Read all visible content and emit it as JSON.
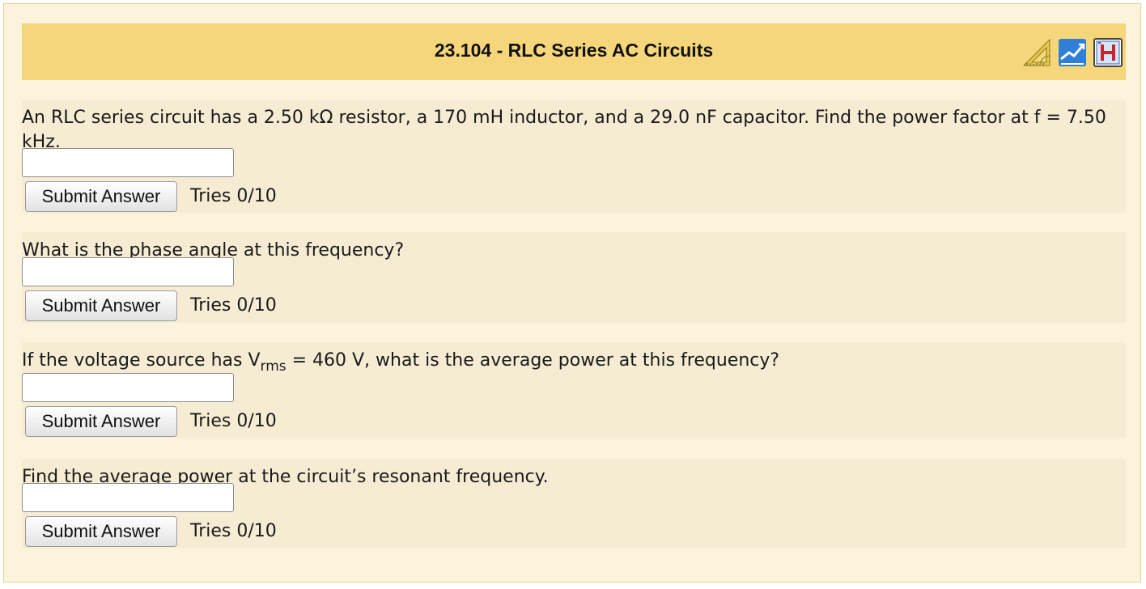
{
  "header": {
    "title": "23.104 - RLC Series AC Circuits",
    "icons": [
      "protractor-ruler-icon",
      "feedback-chart-icon",
      "hint-icon"
    ]
  },
  "questions": [
    {
      "text": "An RLC series circuit has a 2.50 kΩ resistor, a 170 mH inductor, and a 29.0 nF capacitor. Find the power factor at f = 7.50 kHz.",
      "answer_value": "",
      "submit_label": "Submit Answer",
      "tries": "Tries 0/10"
    },
    {
      "text": "What is the phase angle at this frequency?",
      "answer_value": "",
      "submit_label": "Submit Answer",
      "tries": "Tries 0/10"
    },
    {
      "text_before": "If the voltage source has V",
      "text_sub": "rms",
      "text_after": " = 460 V, what is the average power at this frequency?",
      "answer_value": "",
      "submit_label": "Submit Answer",
      "tries": "Tries 0/10"
    },
    {
      "text": "Find the average power at the circuit’s resonant frequency.",
      "answer_value": "",
      "submit_label": "Submit Answer",
      "tries": "Tries 0/10"
    }
  ],
  "colors": {
    "panel_bg": "#fbf3dc",
    "header_bg": "#f6d67a",
    "question_bg": "#f6ecd3",
    "border": "#e6d58c"
  }
}
